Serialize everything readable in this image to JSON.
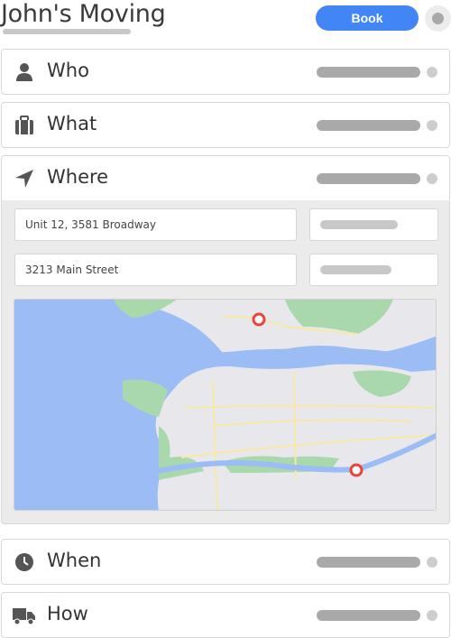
{
  "header": {
    "title": "John's Moving",
    "book_label": "Book"
  },
  "sections": [
    {
      "label": "Who",
      "icon": "person-icon"
    },
    {
      "label": "What",
      "icon": "briefcase-icon"
    },
    {
      "label": "Where",
      "icon": "location-arrow-icon",
      "expanded": true
    },
    {
      "label": "When",
      "icon": "clock-icon"
    },
    {
      "label": "How",
      "icon": "truck-icon"
    }
  ],
  "where": {
    "from_address": "Unit 12, 3581 Broadway",
    "to_address": "3213 Main Street"
  },
  "colors": {
    "accent": "#4285f4",
    "marker": "#e8453c",
    "water": "#9cbcf6",
    "land": "#e8e8ec",
    "park": "#a9d8ad",
    "road": "#f7e8a6"
  }
}
